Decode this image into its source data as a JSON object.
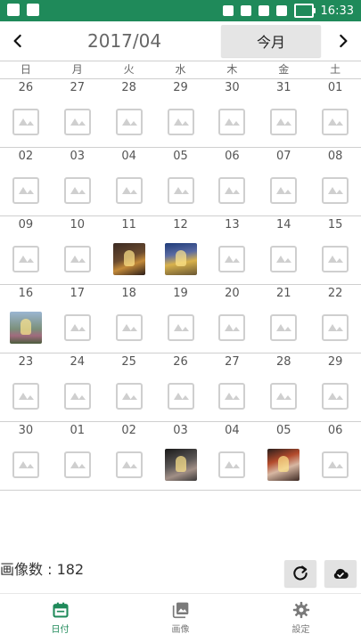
{
  "status_bar": {
    "time": "16:33",
    "left_icons": [
      "image-notification-icon",
      "n-app-icon"
    ],
    "right_icons": [
      "bluetooth-icon",
      "vibrate-icon",
      "wifi-icon",
      "signal-icon",
      "battery-charging-icon"
    ]
  },
  "header": {
    "month_title": "2017/04",
    "today_label": "今月",
    "prev_icon": "chevron-left-icon",
    "next_icon": "chevron-right-icon"
  },
  "weekdays": [
    "日",
    "月",
    "火",
    "水",
    "木",
    "金",
    "土"
  ],
  "weeks": [
    {
      "dates": [
        "26",
        "27",
        "28",
        "29",
        "30",
        "31",
        "01"
      ],
      "cells": [
        "empty",
        "empty",
        "empty",
        "empty",
        "empty",
        "empty",
        "empty"
      ]
    },
    {
      "dates": [
        "02",
        "03",
        "04",
        "05",
        "06",
        "07",
        "08"
      ],
      "cells": [
        "empty",
        "empty",
        "empty",
        "empty",
        "empty",
        "empty",
        "empty"
      ]
    },
    {
      "dates": [
        "09",
        "10",
        "11",
        "12",
        "13",
        "14",
        "15"
      ],
      "cells": [
        "empty",
        "empty",
        "photo-1",
        "photo-2",
        "empty",
        "empty",
        "empty"
      ]
    },
    {
      "dates": [
        "16",
        "17",
        "18",
        "19",
        "20",
        "21",
        "22"
      ],
      "cells": [
        "photo-3",
        "empty",
        "empty",
        "empty",
        "empty",
        "empty",
        "empty"
      ]
    },
    {
      "dates": [
        "23",
        "24",
        "25",
        "26",
        "27",
        "28",
        "29"
      ],
      "cells": [
        "empty",
        "empty",
        "empty",
        "empty",
        "empty",
        "empty",
        "empty"
      ]
    },
    {
      "dates": [
        "30",
        "01",
        "02",
        "03",
        "04",
        "05",
        "06"
      ],
      "cells": [
        "empty",
        "empty",
        "empty",
        "photo-4",
        "empty",
        "photo-5",
        "empty"
      ]
    }
  ],
  "footer": {
    "image_count": "画像数 : 182",
    "refresh_icon": "refresh-icon",
    "cloud_icon": "cloud-check-icon"
  },
  "bottom_nav": {
    "tabs": [
      {
        "label": "日付",
        "icon": "calendar-icon",
        "active": true
      },
      {
        "label": "画像",
        "icon": "gallery-icon",
        "active": false
      },
      {
        "label": "設定",
        "icon": "gear-icon",
        "active": false
      }
    ]
  },
  "colors": {
    "accent": "#1f8a5a",
    "status_bar": "#1f8a5a"
  }
}
